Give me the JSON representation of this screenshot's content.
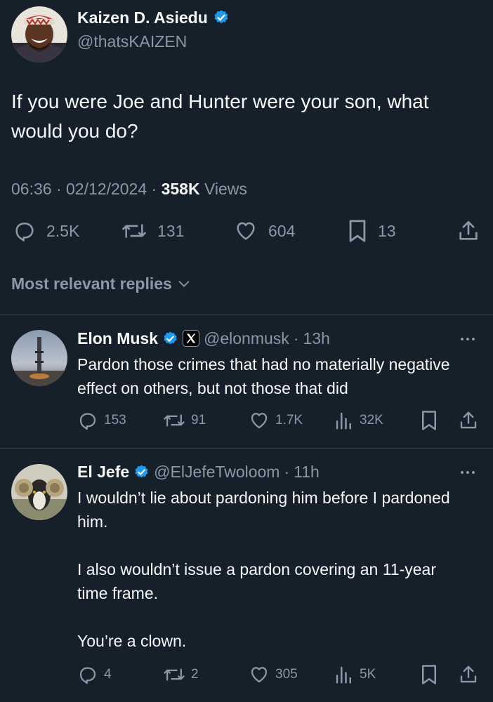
{
  "tweet": {
    "author_name": "Kaizen D. Asiedu",
    "author_handle": "@thatsKAIZEN",
    "text": "If you were Joe and Hunter were your son, what would you do?",
    "time": "06:36",
    "date": "02/12/2024",
    "views_count": "358K",
    "views_label": "Views",
    "replies": "2.5K",
    "retweets": "131",
    "likes": "604",
    "bookmarks": "13"
  },
  "replies_filter": {
    "label": "Most relevant replies"
  },
  "replies": [
    {
      "name": "Elon Musk",
      "handle": "@elonmusk",
      "time": "13h",
      "text": "Pardon those crimes that had no materially negative effect on others, but not those that did",
      "replies": "153",
      "retweets": "91",
      "likes": "1.7K",
      "views": "32K"
    },
    {
      "name": "El Jefe",
      "handle": "@ElJefeTwoloom",
      "time": "11h",
      "text_p1": "I wouldn’t lie about pardoning him before I pardoned him.",
      "text_p2": "I also wouldn’t issue a pardon covering an 11-year time frame.",
      "text_p3": "You’re a clown.",
      "replies": "4",
      "retweets": "2",
      "likes": "305",
      "views": "5K"
    }
  ],
  "colors": {
    "background": "#15202b",
    "text_primary": "#f7f9f9",
    "text_secondary": "#8b98a5",
    "verified_blue": "#1d9bf0",
    "divider": "#38444d"
  },
  "icons": [
    "reply-icon",
    "retweet-icon",
    "like-icon",
    "bookmark-icon",
    "share-icon",
    "views-icon",
    "verified-badge-icon",
    "x-affiliate-icon",
    "chevron-down-icon",
    "more-icon"
  ]
}
